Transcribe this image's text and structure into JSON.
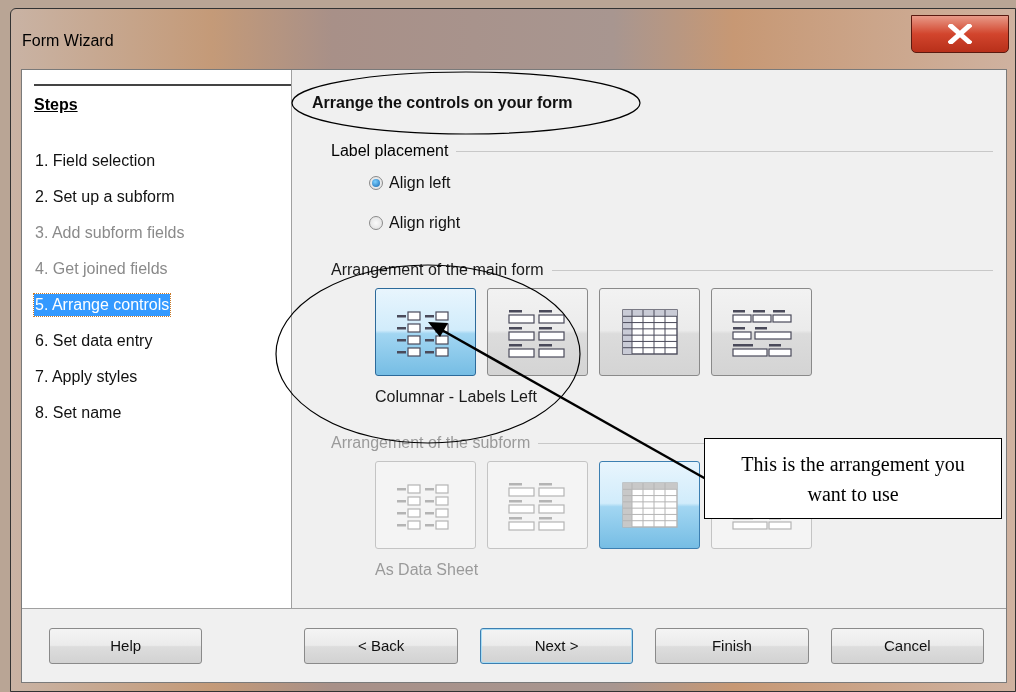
{
  "window": {
    "title": "Form Wizard"
  },
  "steps": {
    "heading": "Steps",
    "items": [
      {
        "label": "1. Field selection",
        "disabled": false,
        "selected": false
      },
      {
        "label": "2. Set up a subform",
        "disabled": false,
        "selected": false
      },
      {
        "label": "3. Add subform fields",
        "disabled": true,
        "selected": false
      },
      {
        "label": "4. Get joined fields",
        "disabled": true,
        "selected": false
      },
      {
        "label": "5. Arrange controls",
        "disabled": false,
        "selected": true
      },
      {
        "label": "6. Set data entry",
        "disabled": false,
        "selected": false
      },
      {
        "label": "7. Apply styles",
        "disabled": false,
        "selected": false
      },
      {
        "label": "8. Set name",
        "disabled": false,
        "selected": false
      }
    ]
  },
  "page_title": "Arrange the controls on your form",
  "label_placement": {
    "title": "Label placement",
    "options": [
      {
        "label": "Align left",
        "selected": true
      },
      {
        "label": "Align right",
        "selected": false
      }
    ]
  },
  "main_form": {
    "title": "Arrangement of the main form",
    "disabled": false,
    "caption": "Columnar - Labels Left",
    "layouts": [
      {
        "kind": "columnar-left",
        "selected": true
      },
      {
        "kind": "columnar-top",
        "selected": false
      },
      {
        "kind": "datasheet",
        "selected": false
      },
      {
        "kind": "blocks-top",
        "selected": false
      }
    ]
  },
  "subform": {
    "title": "Arrangement of the subform",
    "disabled": true,
    "caption": "As Data Sheet",
    "layouts": [
      {
        "kind": "columnar-left",
        "selected": false
      },
      {
        "kind": "columnar-top",
        "selected": false
      },
      {
        "kind": "datasheet",
        "selected": true
      },
      {
        "kind": "blocks-top",
        "selected": false
      }
    ]
  },
  "buttons": [
    {
      "label": "Help",
      "kind": "help",
      "focused": false
    },
    {
      "label": "< Back",
      "kind": "nav",
      "focused": false
    },
    {
      "label": "Next >",
      "kind": "nav",
      "focused": true
    },
    {
      "label": "Finish",
      "kind": "nav",
      "focused": false
    },
    {
      "label": "Cancel",
      "kind": "nav",
      "focused": false
    }
  ],
  "callout": {
    "text": "This is the arrangement you want to use"
  }
}
